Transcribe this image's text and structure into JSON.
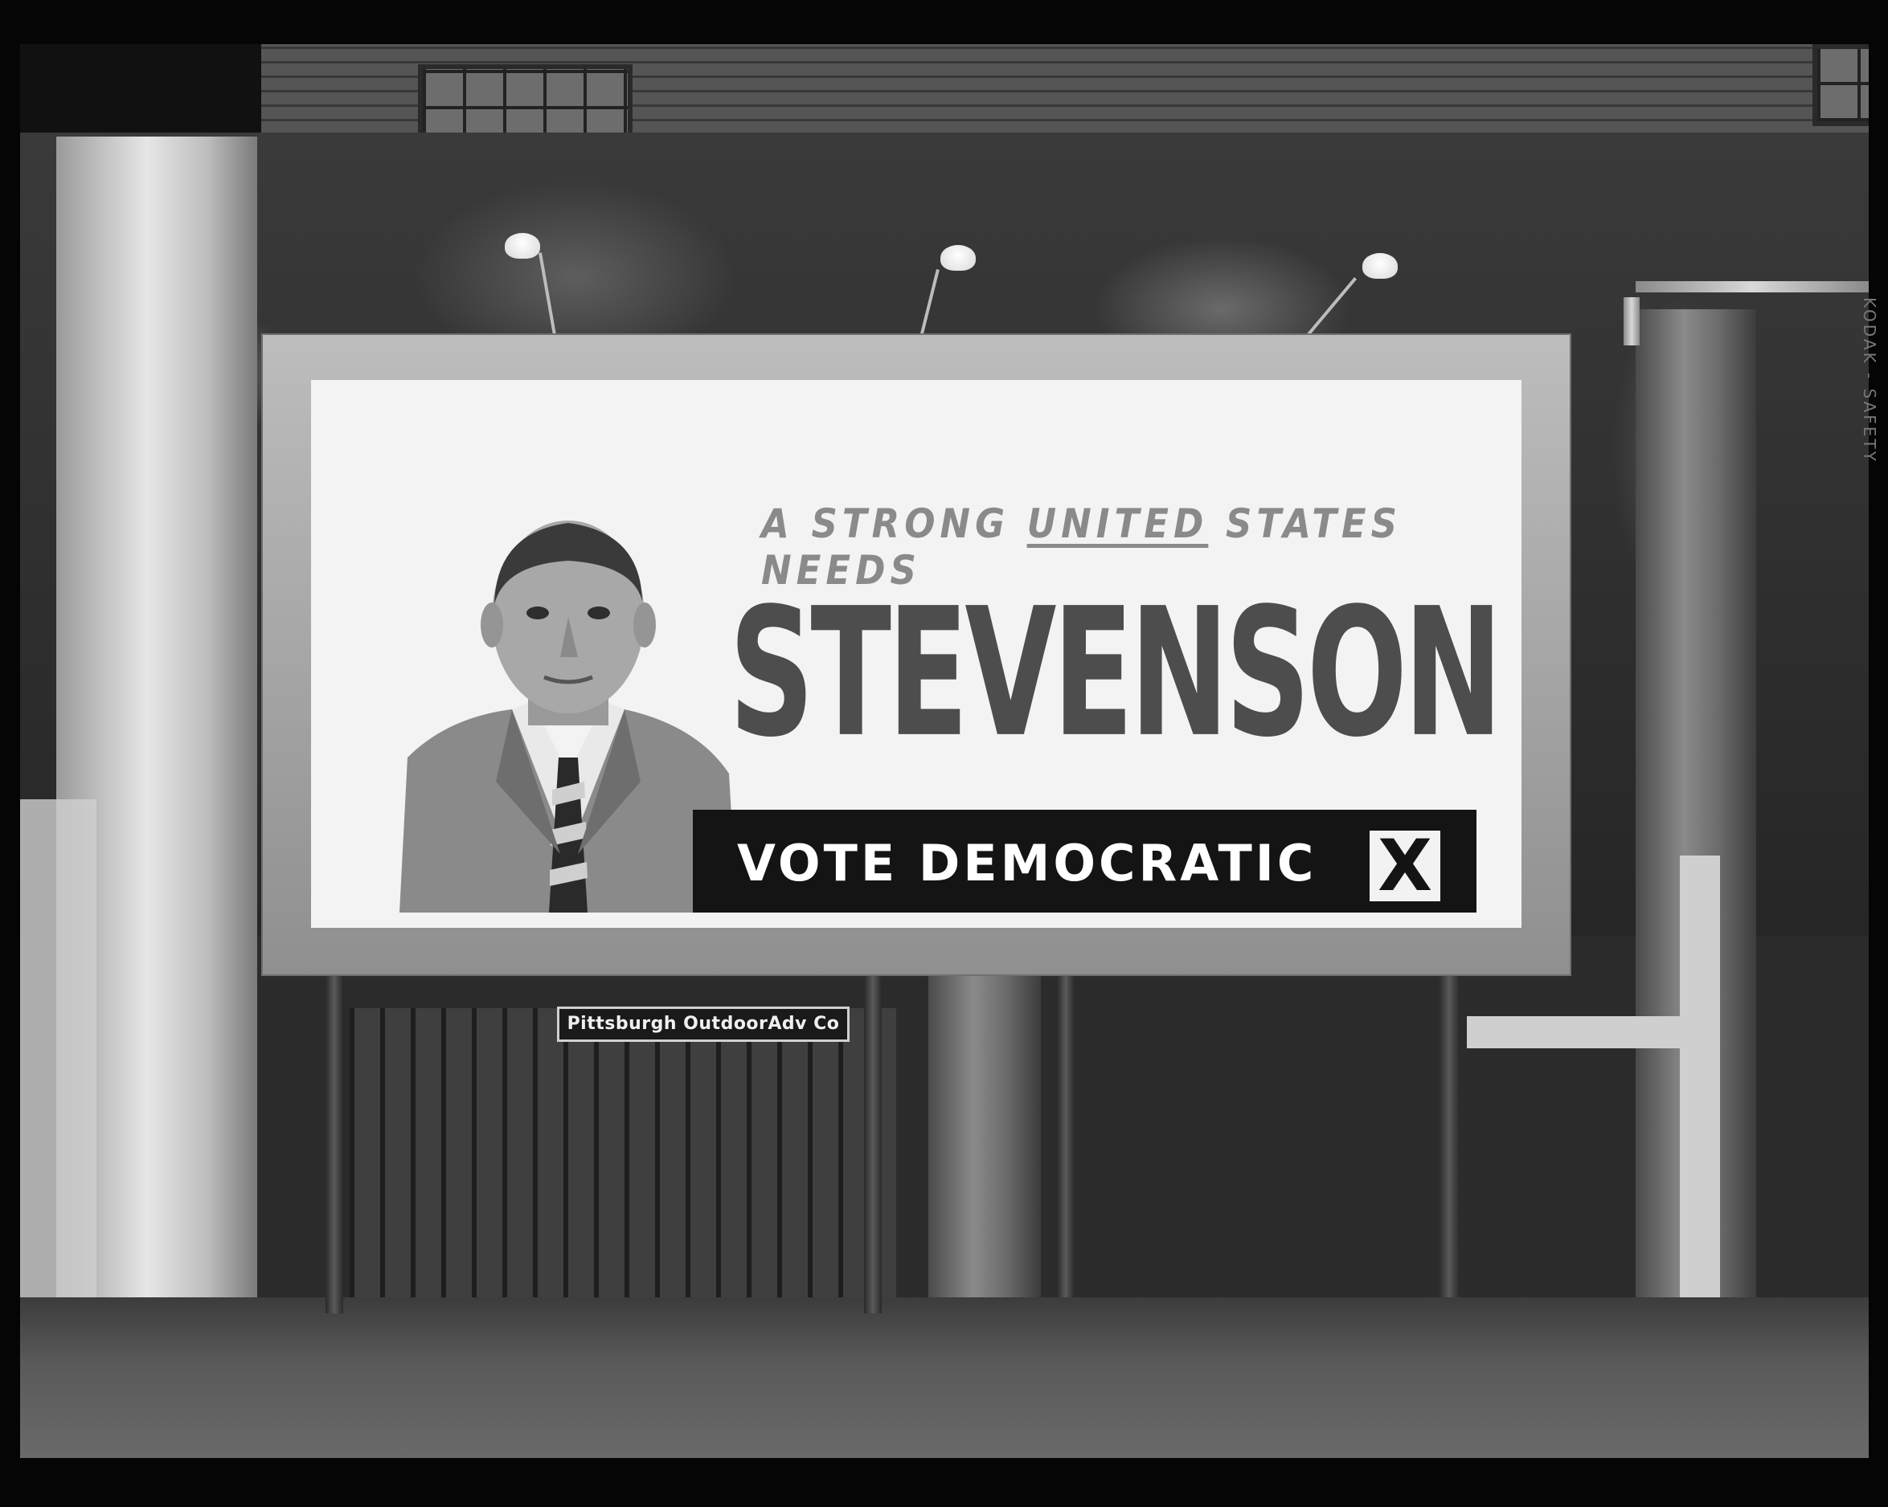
{
  "billboard": {
    "headline_before": "A STRONG ",
    "headline_underlined": "UNITED",
    "headline_after": " STATES NEEDS",
    "name": "STEVENSON",
    "vote": "VOTE DEMOCRATIC",
    "x_mark": "X",
    "credit": "Pittsburgh OutdoorAdv Co"
  },
  "film_edge": "KODAK - SAFETY"
}
